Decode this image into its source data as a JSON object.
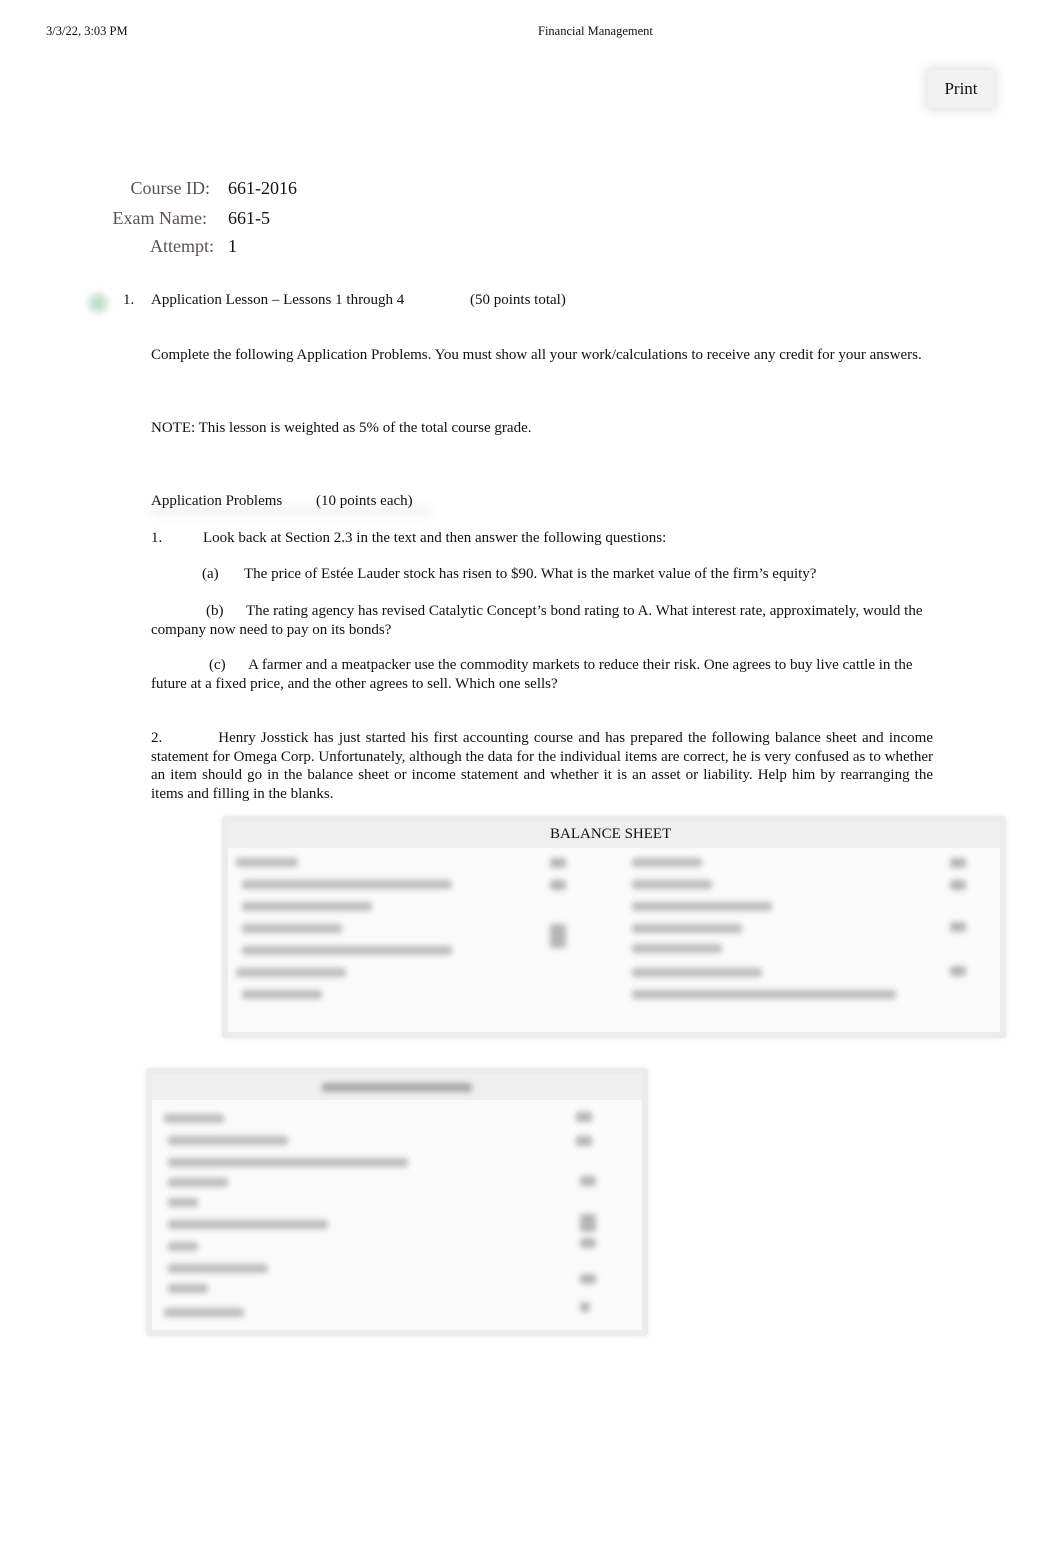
{
  "print_header": {
    "datetime": "3/3/22, 3:03 PM",
    "title": "Financial Management"
  },
  "toolbar": {
    "print_label": "Print"
  },
  "exam_info": {
    "course_id_label": "Course ID:",
    "course_id_value": "661-2016",
    "exam_name_label": "Exam Name:",
    "exam_name_value": "661-5",
    "attempt_label": "Attempt:",
    "attempt_value": "1"
  },
  "question": {
    "number": "1.",
    "title": "Application Lesson – Lessons 1 through 4",
    "points": "(50 points total)",
    "status_icon": "check-icon",
    "status_color": "#50a06e",
    "instructions": "Complete the following Application Problems. You must show all your work/calculations to receive any credit for your answers.",
    "note": "NOTE: This lesson is weighted as 5% of the total course grade.",
    "section_heading": "Application Problems",
    "section_points": "(10 points each)",
    "problems": [
      {
        "number": "1.",
        "text": "Look back at Section 2.3 in the text and then answer the following questions:",
        "parts": [
          {
            "label": "(a)",
            "text": "The price of Estée Lauder stock has risen to $90. What is the market value of the firm’s equity?"
          },
          {
            "label": "(b)",
            "text": "The rating agency has revised Catalytic Concept’s bond rating to A. What interest rate, approximately, would the company now need to pay on its bonds?"
          },
          {
            "label": "(c)",
            "text": "A farmer and a meatpacker use the commodity markets to reduce their risk. One agrees to buy live cattle in the future at a fixed price, and the other agrees to sell. Which one sells?"
          }
        ]
      },
      {
        "number": "2.",
        "text": "Henry Josstick has just started his first accounting course and has prepared the following balance sheet and income statement for Omega Corp. Unfortunately, although the data for the individual items are correct, he is very confused as to whether an item should go in the balance sheet or income statement and whether it is an asset or liability. Help him by rearranging the items and filling in the blanks."
      }
    ],
    "balance_sheet": {
      "title": "BALANCE SHEET",
      "content_obscured": true
    },
    "income_statement": {
      "content_obscured": true
    }
  }
}
